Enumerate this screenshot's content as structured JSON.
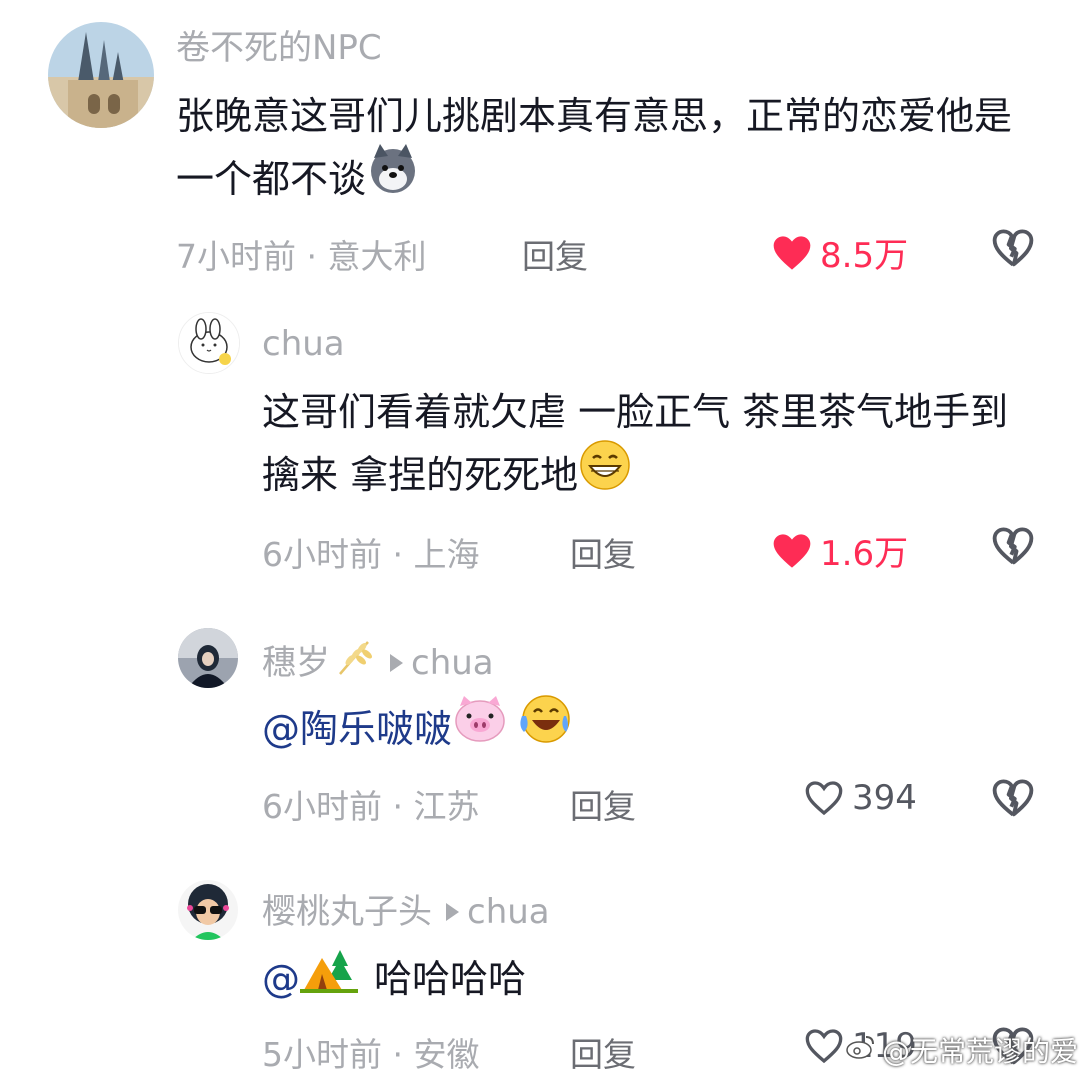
{
  "comments": [
    {
      "username": "卷不死的NPC",
      "reply_to": "",
      "text": "张晚意这哥们儿挑剧本真有意思，正常的恋爱他是一个都不谈",
      "time": "7小时前",
      "location": "意大利",
      "reply_label": "回复",
      "likes": "8.5万",
      "liked": true
    },
    {
      "username": "chua",
      "reply_to": "",
      "text": "这哥们看着就欠虐 一脸正气 茶里茶气地手到擒来 拿捏的死死地",
      "time": "6小时前",
      "location": "上海",
      "reply_label": "回复",
      "likes": "1.6万",
      "liked": true
    },
    {
      "username": "穗岁",
      "reply_to": "chua",
      "mention": "@陶乐啵啵",
      "text": "",
      "time": "6小时前",
      "location": "江苏",
      "reply_label": "回复",
      "likes": "394",
      "liked": false
    },
    {
      "username": "樱桃丸子头",
      "reply_to": "chua",
      "mention": "@",
      "text": "哈哈哈哈",
      "time": "5小时前",
      "location": "安徽",
      "reply_label": "回复",
      "likes": "119",
      "liked": false
    }
  ],
  "meta_separator": "·",
  "watermark": "@无常荒谬的爱",
  "colors": {
    "like_red": "#fe2c55",
    "meta_gray": "#a9abb0",
    "mention_blue": "#1e3a8a"
  }
}
